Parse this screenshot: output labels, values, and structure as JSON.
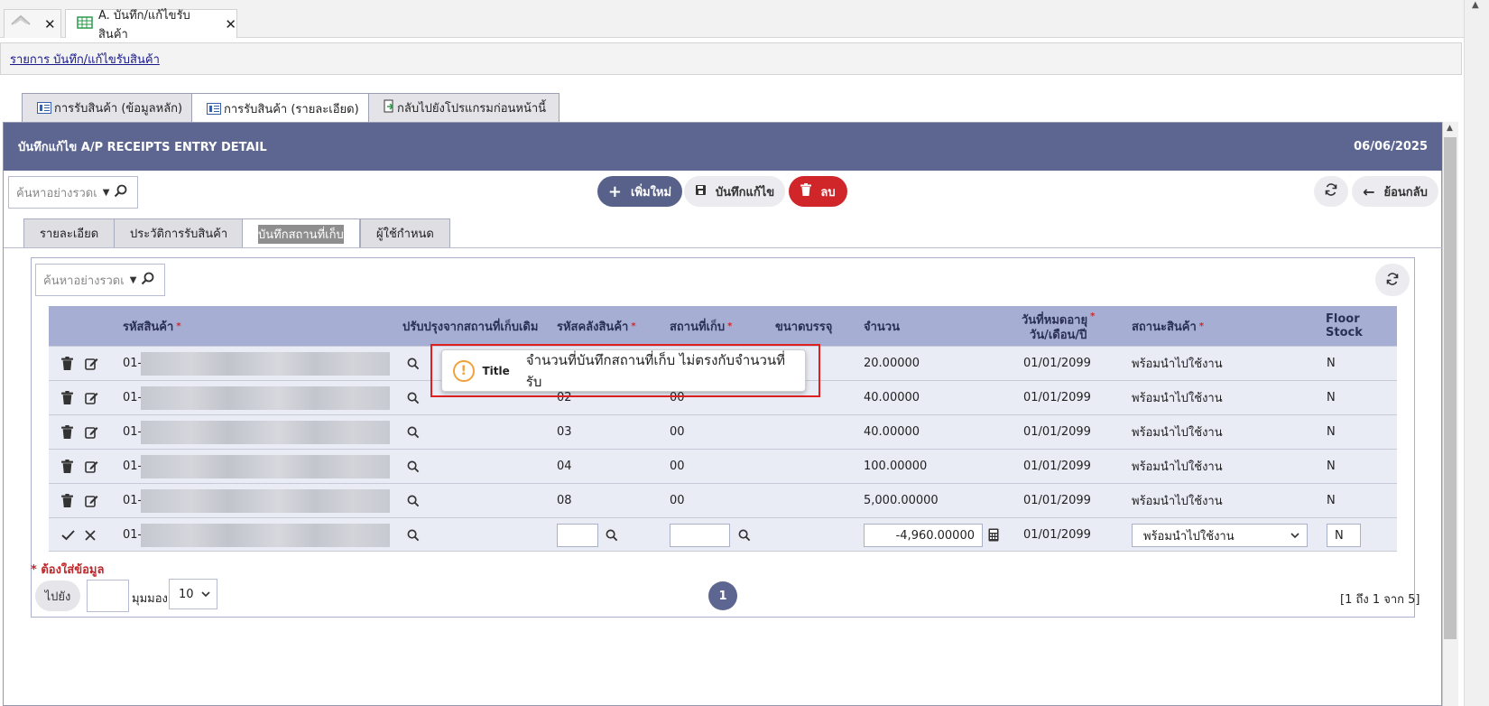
{
  "window_tabs": {
    "home_icon": "home-icon",
    "main_tab_label": "A. บันทึก/แก้ไขรับสินค้า",
    "close_glyph": "✕"
  },
  "breadcrumb": "รายการ บันทึก/แก้ไขรับสินค้า",
  "page_tabs": [
    {
      "label": "การรับสินค้า (ข้อมูลหลัก)"
    },
    {
      "label": "การรับสินค้า (รายละเอียด)"
    },
    {
      "label": "กลับไปยังโปรแกรมก่อนหน้านี้"
    }
  ],
  "header": {
    "title": "บันทึกแก้ไข A/P RECEIPTS ENTRY DETAIL",
    "date": "06/06/2025"
  },
  "search": {
    "placeholder": "ค้นหาอย่างรวดเ"
  },
  "toolbar": {
    "add_label": "เพิ่มใหม่",
    "save_label": "บันทึกแก้ไข",
    "delete_label": "ลบ",
    "back_label": "ย้อนกลับ"
  },
  "inner_tabs": [
    {
      "label": "รายละเอียด"
    },
    {
      "label": "ประวัติการรับสินค้า"
    },
    {
      "label": "บันทึกสถานที่เก็บ"
    },
    {
      "label": "ผู้ใช้กำหนด"
    }
  ],
  "grid": {
    "columns": {
      "product_code": "รหัสสินค้า",
      "adjust_from": "ปรับปรุงจากสถานที่เก็บเดิม",
      "warehouse": "รหัสคลังสินค้า",
      "location": "สถานที่เก็บ",
      "pack_size": "ขนาดบรรจุ",
      "quantity": "จำนวน",
      "expiry_line1": "วันที่หมดอายุ",
      "expiry_line2": "วัน/เดือน/ปี",
      "status": "สถานะสินค้า",
      "floor_stock": "Floor Stock"
    },
    "rows": [
      {
        "code": "01-",
        "warehouse": "",
        "location": "",
        "quantity": "20.00000",
        "expiry": "01/01/2099",
        "status": "พร้อมนำไปใช้งาน",
        "floor": "N"
      },
      {
        "code": "01-",
        "warehouse": "02",
        "location": "00",
        "quantity": "40.00000",
        "expiry": "01/01/2099",
        "status": "พร้อมนำไปใช้งาน",
        "floor": "N"
      },
      {
        "code": "01-",
        "warehouse": "03",
        "location": "00",
        "quantity": "40.00000",
        "expiry": "01/01/2099",
        "status": "พร้อมนำไปใช้งาน",
        "floor": "N"
      },
      {
        "code": "01-",
        "warehouse": "04",
        "location": "00",
        "quantity": "100.00000",
        "expiry": "01/01/2099",
        "status": "พร้อมนำไปใช้งาน",
        "floor": "N"
      },
      {
        "code": "01-",
        "warehouse": "08",
        "location": "00",
        "quantity": "5,000.00000",
        "expiry": "01/01/2099",
        "status": "พร้อมนำไปใช้งาน",
        "floor": "N"
      }
    ],
    "edit_row": {
      "code": "01-",
      "warehouse_value": "",
      "location_value": "",
      "quantity_value": "-4,960.00000",
      "expiry": "01/01/2099",
      "status_value": "พร้อมนำไปใช้งาน",
      "floor_value": "N"
    }
  },
  "alert": {
    "title": "Title",
    "message": "จำนวนที่บันทึกสถานที่เก็บ ไม่ตรงกับจำนวนที่รับ",
    "icon": "!"
  },
  "required_note": "* ต้องใส่ข้อมูล",
  "pager": {
    "goto_label": "ไปยัง",
    "view_label": "มุมมอง",
    "page_size": "10",
    "current_page": "1",
    "info": "[1 ถึง 1 จาก 5]"
  }
}
